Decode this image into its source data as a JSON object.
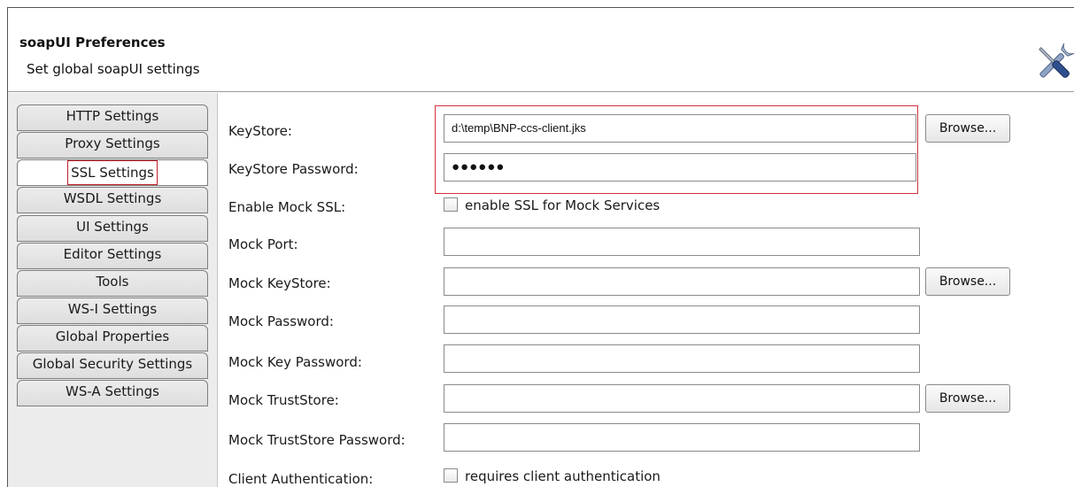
{
  "header": {
    "title": "soapUI Preferences",
    "subtitle": "Set global soapUI settings",
    "icon": "tools-icon"
  },
  "tabs": [
    {
      "label": "HTTP Settings"
    },
    {
      "label": "Proxy Settings"
    },
    {
      "label": "SSL Settings",
      "selected": true
    },
    {
      "label": "WSDL Settings"
    },
    {
      "label": "UI Settings"
    },
    {
      "label": "Editor Settings"
    },
    {
      "label": "Tools"
    },
    {
      "label": "WS-I Settings"
    },
    {
      "label": "Global Properties"
    },
    {
      "label": "Global Security Settings"
    },
    {
      "label": "WS-A Settings"
    }
  ],
  "form": {
    "keystore": {
      "label": "KeyStore:",
      "value": "d:\\temp\\BNP-ccs-client.jks"
    },
    "keystore_password": {
      "label": "KeyStore Password:",
      "value": "●●●●●●"
    },
    "enable_mock_ssl": {
      "label": "Enable Mock SSL:",
      "checkbox_label": "enable SSL for Mock Services",
      "checked": false
    },
    "mock_port": {
      "label": "Mock Port:",
      "value": ""
    },
    "mock_keystore": {
      "label": "Mock KeyStore:",
      "value": ""
    },
    "mock_password": {
      "label": "Mock Password:",
      "value": ""
    },
    "mock_key_password": {
      "label": "Mock Key Password:",
      "value": ""
    },
    "mock_truststore": {
      "label": "Mock TrustStore:",
      "value": ""
    },
    "mock_truststore_password": {
      "label": "Mock TrustStore Password:",
      "value": ""
    },
    "client_authentication": {
      "label": "Client Authentication:",
      "checkbox_label": "requires client authentication",
      "checked": false
    }
  },
  "buttons": {
    "browse": "Browse..."
  },
  "colors": {
    "highlight": "#d4303a",
    "tab_panel": "#ececec"
  }
}
